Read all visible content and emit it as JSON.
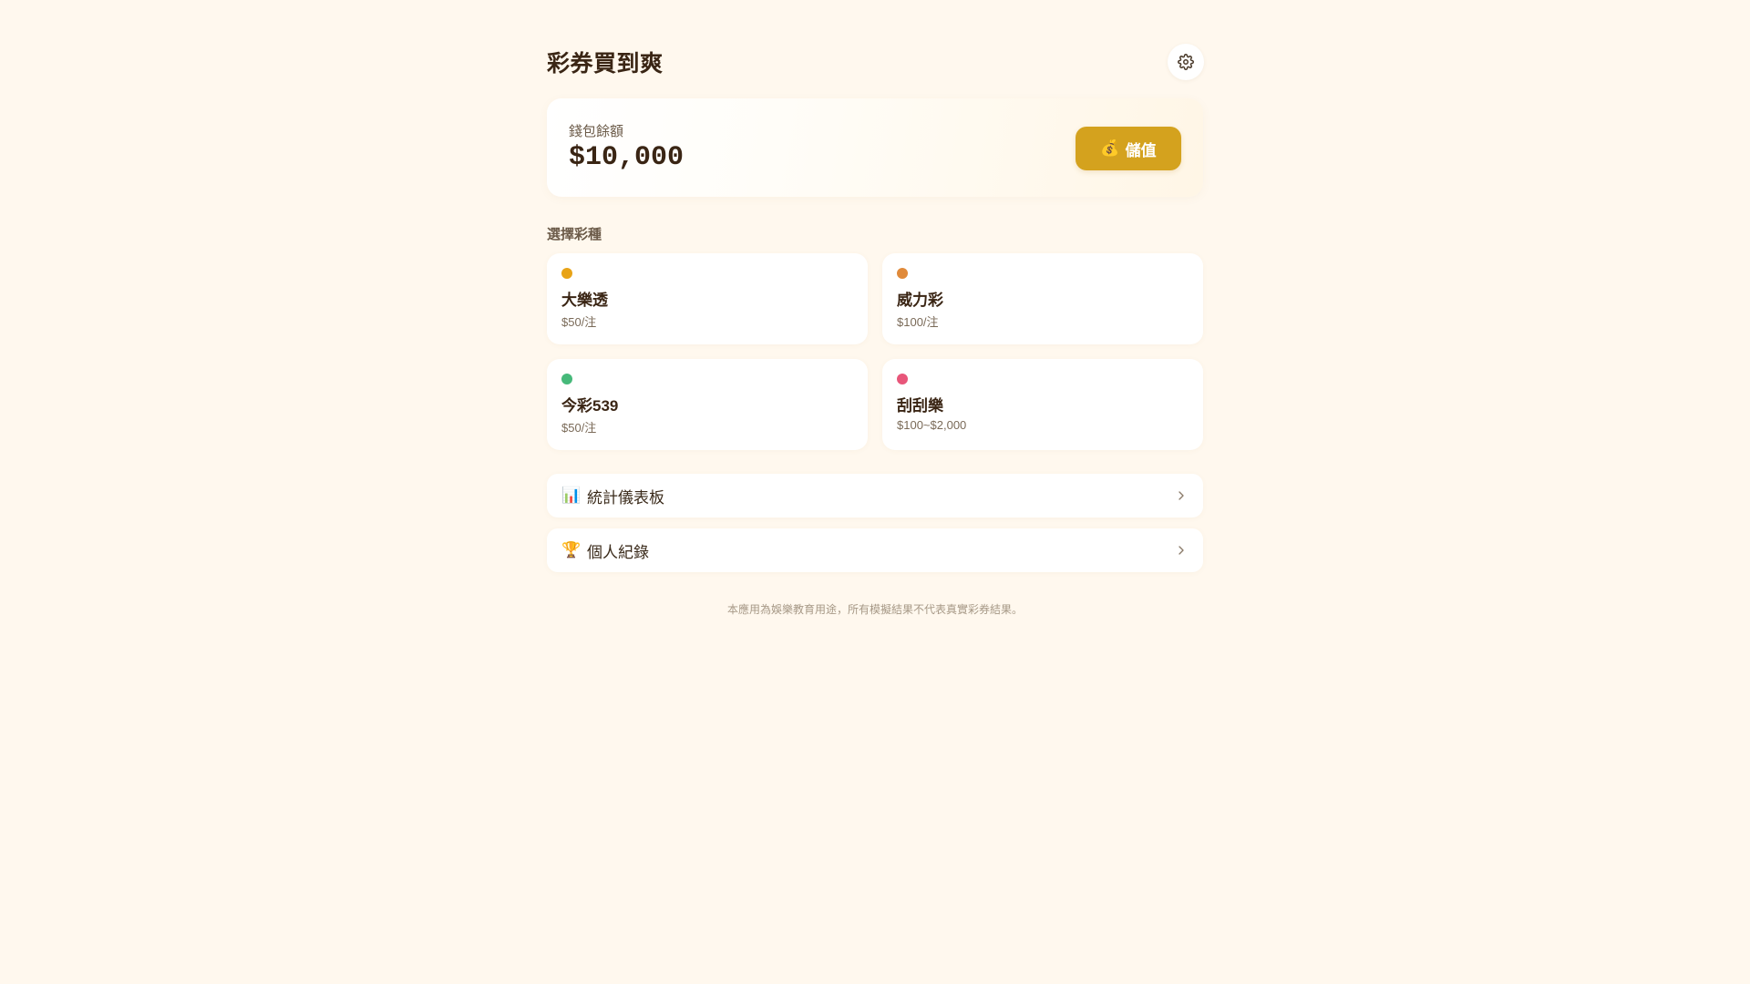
{
  "header": {
    "title": "彩券買到爽",
    "settings_icon": "gear-icon"
  },
  "wallet": {
    "label": "錢包餘額",
    "amount": "$10,000",
    "topup": {
      "emoji": "💰",
      "label": "儲值"
    }
  },
  "games_section": {
    "title": "選擇彩種",
    "items": [
      {
        "name": "大樂透",
        "price": "$50/注",
        "dot_color": "#E8A317"
      },
      {
        "name": "威力彩",
        "price": "$100/注",
        "dot_color": "#E08A3A"
      },
      {
        "name": "今彩539",
        "price": "$50/注",
        "dot_color": "#46B97A"
      },
      {
        "name": "刮刮樂",
        "price": "$100~$2,000",
        "dot_color": "#E8567A"
      }
    ]
  },
  "menu": [
    {
      "emoji": "📊",
      "label": "統計儀表板",
      "icon": "chart-icon"
    },
    {
      "emoji": "🏆",
      "label": "個人紀錄",
      "icon": "trophy-icon"
    }
  ],
  "footer": {
    "disclaimer": "本應用為娛樂教育用途，所有模擬結果不代表真實彩券結果。"
  },
  "colors": {
    "background": "#FFF8EE",
    "accent": "#D4A21E",
    "text": "#3A2514"
  }
}
